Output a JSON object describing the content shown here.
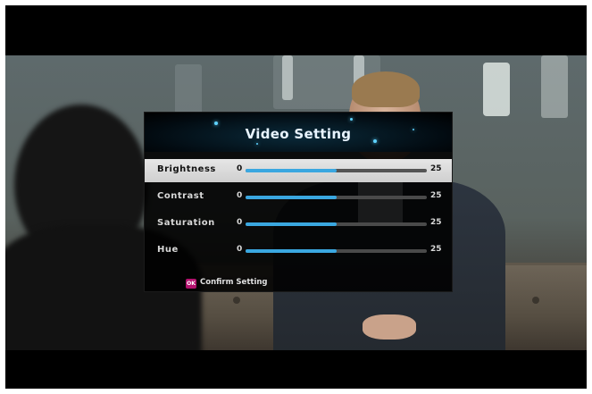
{
  "osd": {
    "title": "Video Setting",
    "settings": [
      {
        "label": "Brightness",
        "min": "0",
        "max": "25",
        "value_fraction": 0.5,
        "selected": true
      },
      {
        "label": "Contrast",
        "min": "0",
        "max": "25",
        "value_fraction": 0.5,
        "selected": false
      },
      {
        "label": "Saturation",
        "min": "0",
        "max": "25",
        "value_fraction": 0.5,
        "selected": false
      },
      {
        "label": "Hue",
        "min": "0",
        "max": "25",
        "value_fraction": 0.5,
        "selected": false
      }
    ],
    "confirm": {
      "key_label": "OK",
      "label": "Confirm Setting"
    }
  },
  "colors": {
    "slider_fill": "#3aa7e0",
    "selected_row": "#dcdcdc",
    "ok_key": "#b3126e"
  }
}
